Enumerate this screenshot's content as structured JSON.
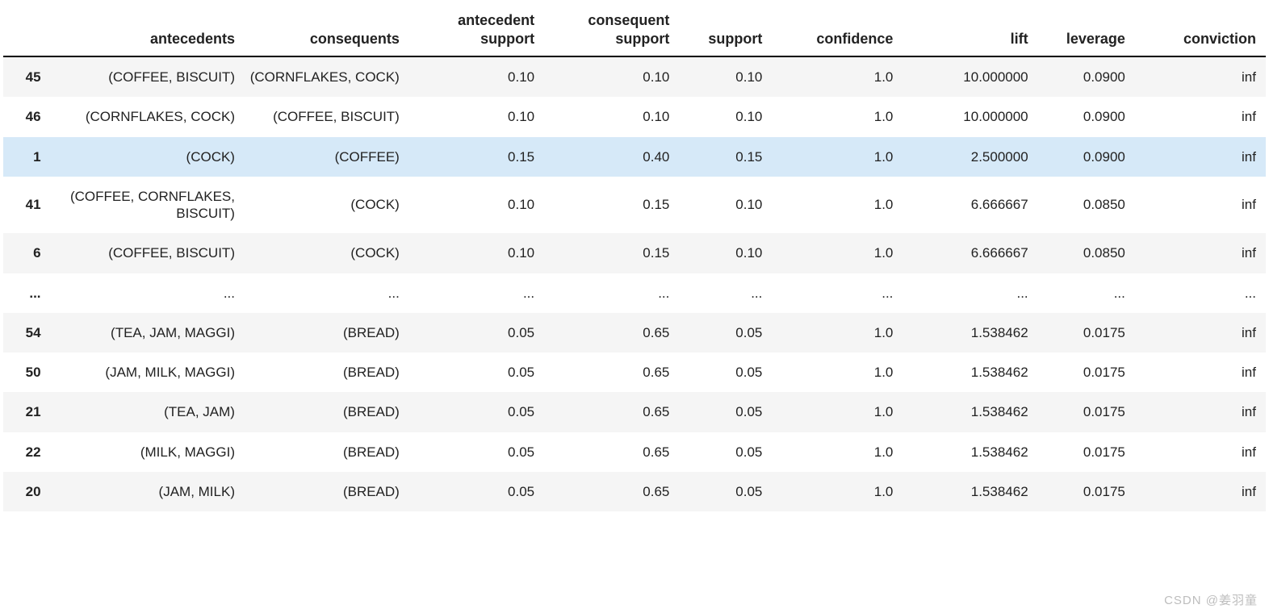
{
  "headers": {
    "index": "",
    "antecedents": "antecedents",
    "consequents": "consequents",
    "antecedent_support": "antecedent support",
    "consequent_support": "consequent support",
    "support": "support",
    "confidence": "confidence",
    "lift": "lift",
    "leverage": "leverage",
    "conviction": "conviction"
  },
  "rows": [
    {
      "idx": "45",
      "antecedents": "(COFFEE, BISCUIT)",
      "consequents": "(CORNFLAKES, COCK)",
      "antecedent_support": "0.10",
      "consequent_support": "0.10",
      "support": "0.10",
      "confidence": "1.0",
      "lift": "10.000000",
      "leverage": "0.0900",
      "conviction": "inf",
      "selected": false
    },
    {
      "idx": "46",
      "antecedents": "(CORNFLAKES, COCK)",
      "consequents": "(COFFEE, BISCUIT)",
      "antecedent_support": "0.10",
      "consequent_support": "0.10",
      "support": "0.10",
      "confidence": "1.0",
      "lift": "10.000000",
      "leverage": "0.0900",
      "conviction": "inf",
      "selected": false
    },
    {
      "idx": "1",
      "antecedents": "(COCK)",
      "consequents": "(COFFEE)",
      "antecedent_support": "0.15",
      "consequent_support": "0.40",
      "support": "0.15",
      "confidence": "1.0",
      "lift": "2.500000",
      "leverage": "0.0900",
      "conviction": "inf",
      "selected": true
    },
    {
      "idx": "41",
      "antecedents": "(COFFEE, CORNFLAKES, BISCUIT)",
      "consequents": "(COCK)",
      "antecedent_support": "0.10",
      "consequent_support": "0.15",
      "support": "0.10",
      "confidence": "1.0",
      "lift": "6.666667",
      "leverage": "0.0850",
      "conviction": "inf",
      "selected": false
    },
    {
      "idx": "6",
      "antecedents": "(COFFEE, BISCUIT)",
      "consequents": "(COCK)",
      "antecedent_support": "0.10",
      "consequent_support": "0.15",
      "support": "0.10",
      "confidence": "1.0",
      "lift": "6.666667",
      "leverage": "0.0850",
      "conviction": "inf",
      "selected": false
    },
    {
      "idx": "...",
      "antecedents": "...",
      "consequents": "...",
      "antecedent_support": "...",
      "consequent_support": "...",
      "support": "...",
      "confidence": "...",
      "lift": "...",
      "leverage": "...",
      "conviction": "...",
      "selected": false
    },
    {
      "idx": "54",
      "antecedents": "(TEA, JAM, MAGGI)",
      "consequents": "(BREAD)",
      "antecedent_support": "0.05",
      "consequent_support": "0.65",
      "support": "0.05",
      "confidence": "1.0",
      "lift": "1.538462",
      "leverage": "0.0175",
      "conviction": "inf",
      "selected": false
    },
    {
      "idx": "50",
      "antecedents": "(JAM, MILK, MAGGI)",
      "consequents": "(BREAD)",
      "antecedent_support": "0.05",
      "consequent_support": "0.65",
      "support": "0.05",
      "confidence": "1.0",
      "lift": "1.538462",
      "leverage": "0.0175",
      "conviction": "inf",
      "selected": false
    },
    {
      "idx": "21",
      "antecedents": "(TEA, JAM)",
      "consequents": "(BREAD)",
      "antecedent_support": "0.05",
      "consequent_support": "0.65",
      "support": "0.05",
      "confidence": "1.0",
      "lift": "1.538462",
      "leverage": "0.0175",
      "conviction": "inf",
      "selected": false
    },
    {
      "idx": "22",
      "antecedents": "(MILK, MAGGI)",
      "consequents": "(BREAD)",
      "antecedent_support": "0.05",
      "consequent_support": "0.65",
      "support": "0.05",
      "confidence": "1.0",
      "lift": "1.538462",
      "leverage": "0.0175",
      "conviction": "inf",
      "selected": false
    },
    {
      "idx": "20",
      "antecedents": "(JAM, MILK)",
      "consequents": "(BREAD)",
      "antecedent_support": "0.05",
      "consequent_support": "0.65",
      "support": "0.05",
      "confidence": "1.0",
      "lift": "1.538462",
      "leverage": "0.0175",
      "conviction": "inf",
      "selected": false
    }
  ],
  "watermark": "CSDN @姜羽童"
}
